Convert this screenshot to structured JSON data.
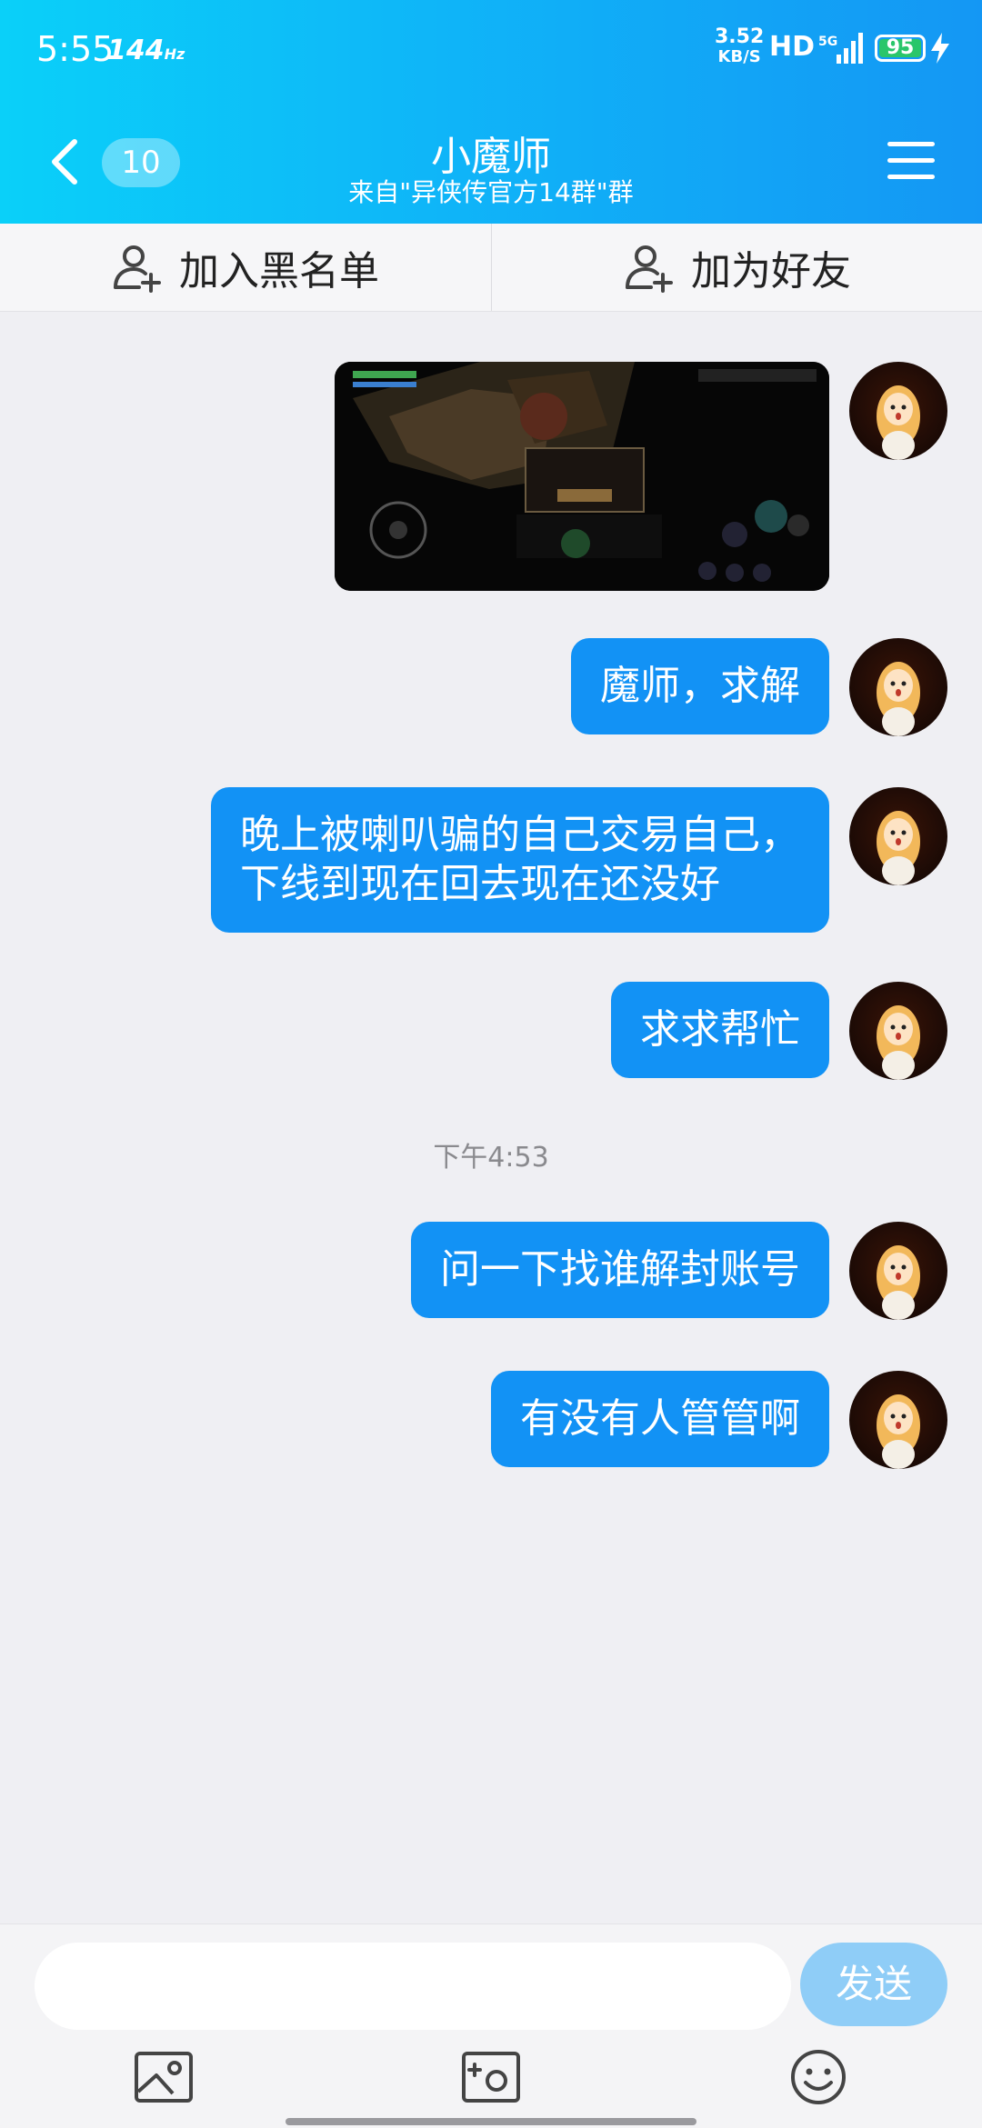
{
  "status_bar": {
    "time": "5:55",
    "refresh_rate": "144",
    "refresh_unit": "Hz",
    "net_speed_value": "3.52",
    "net_speed_unit": "KB/S",
    "hd": "HD",
    "network": "5G",
    "battery": "95"
  },
  "header": {
    "unread_count": "10",
    "title": "小魔师",
    "subtitle": "来自\"异侠传官方14群\"群"
  },
  "actions": {
    "block_label": "加入黑名单",
    "add_friend_label": "加为好友"
  },
  "messages": [
    {
      "type": "image",
      "text": ""
    },
    {
      "type": "text",
      "text": "魔师，求解"
    },
    {
      "type": "text",
      "text": "晚上被喇叭骗的自己交易自己，\n下线到现在回去现在还没好"
    },
    {
      "type": "text",
      "text": "求求帮忙"
    },
    {
      "type": "text",
      "text": "问一下找谁解封账号"
    },
    {
      "type": "text",
      "text": "有没有人管管啊"
    }
  ],
  "timestamp": "下午4:53",
  "input": {
    "value": "",
    "placeholder": "",
    "send_label": "发送"
  },
  "icons": {
    "back": "chevron-left-icon",
    "menu": "hamburger-icon",
    "add_user": "add-user-icon",
    "image": "image-icon",
    "camera": "camera-icon",
    "emoji": "emoji-icon"
  },
  "colors": {
    "header_start": "#0ad0f9",
    "header_end": "#1497f4",
    "bubble": "#1292f5",
    "send_button": "#8fcdf7",
    "battery_fill": "#2ac66a"
  }
}
